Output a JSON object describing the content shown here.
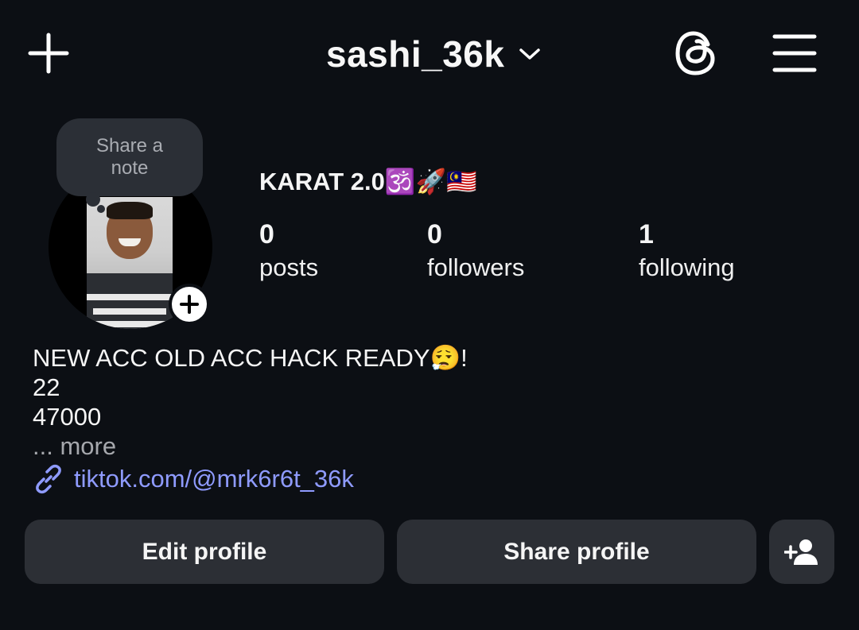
{
  "header": {
    "username": "sashi_36k",
    "icons": [
      "plus-icon",
      "chevron-down-icon",
      "threads-icon",
      "menu-icon"
    ]
  },
  "profile": {
    "note_placeholder": "Share a note",
    "display_name": "KARAT 2.0🕉️🚀🇲🇾",
    "stats": {
      "posts": {
        "value": "0",
        "label": "posts"
      },
      "followers": {
        "value": "0",
        "label": "followers"
      },
      "following": {
        "value": "1",
        "label": "following"
      }
    },
    "bio": {
      "line1": "NEW ACC OLD ACC HACK READY😮‍💨!",
      "line2": "22",
      "line3": "47000",
      "more": "... more"
    },
    "link": "tiktok.com/@mrk6r6t_36k"
  },
  "actions": {
    "edit": "Edit profile",
    "share": "Share profile"
  },
  "colors": {
    "background": "#0c0f14",
    "button": "#2c2f35",
    "link": "#8f9bff"
  }
}
